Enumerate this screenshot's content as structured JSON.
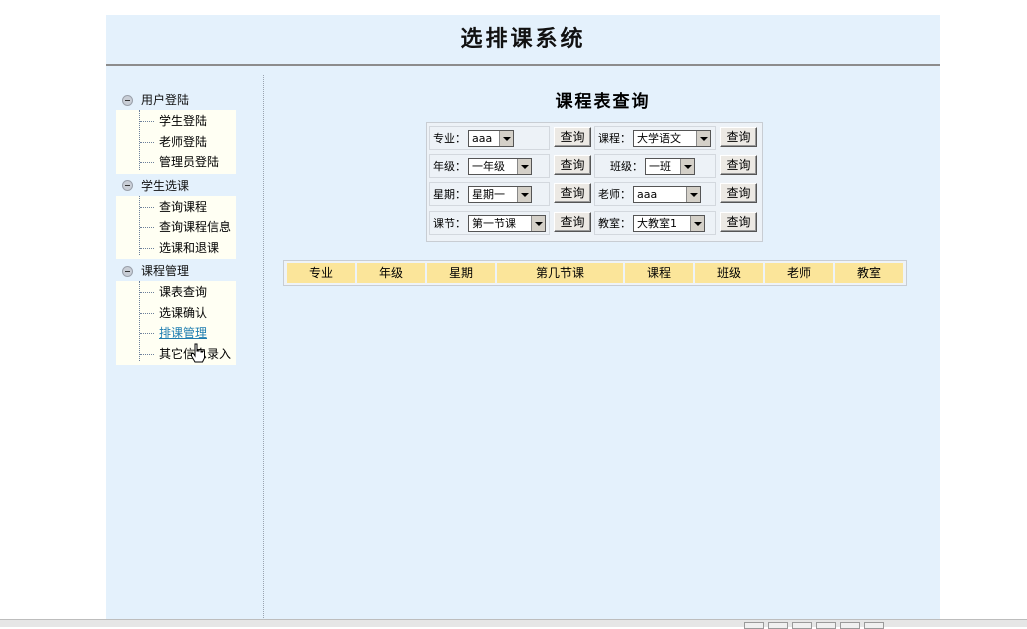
{
  "app": {
    "title": "选排课系统"
  },
  "sidebar": {
    "groups": [
      {
        "label": "用户登陆",
        "items": [
          {
            "label": "学生登陆"
          },
          {
            "label": "老师登陆"
          },
          {
            "label": "管理员登陆"
          }
        ]
      },
      {
        "label": "学生选课",
        "items": [
          {
            "label": "查询课程"
          },
          {
            "label": "查询课程信息"
          },
          {
            "label": "选课和退课"
          }
        ]
      },
      {
        "label": "课程管理",
        "items": [
          {
            "label": "课表查询"
          },
          {
            "label": "选课确认"
          },
          {
            "label": "排课管理"
          },
          {
            "label": "其它信息录入"
          }
        ]
      }
    ],
    "active_item": "排课管理"
  },
  "main": {
    "title": "课程表查询",
    "query_button_label": "查询",
    "filters": {
      "major": {
        "label": "专业：",
        "value": "aaa"
      },
      "course": {
        "label": "课程：",
        "value": "大学语文"
      },
      "grade": {
        "label": "年级：",
        "value": "一年级"
      },
      "class": {
        "label": "班级：",
        "value": "一班"
      },
      "weekday": {
        "label": "星期：",
        "value": "星期一"
      },
      "teacher": {
        "label": "老师：",
        "value": "aaa"
      },
      "period": {
        "label": "课节：",
        "value": "第一节课"
      },
      "room": {
        "label": "教室：",
        "value": "大教室1"
      }
    },
    "table": {
      "columns": [
        "专业",
        "年级",
        "星期",
        "第几节课",
        "课程",
        "班级",
        "老师",
        "教室"
      ]
    }
  },
  "colors": {
    "page_bg": "#e4f1fc",
    "header_accent": "#fbe59a",
    "active_link": "#1e7db0"
  }
}
